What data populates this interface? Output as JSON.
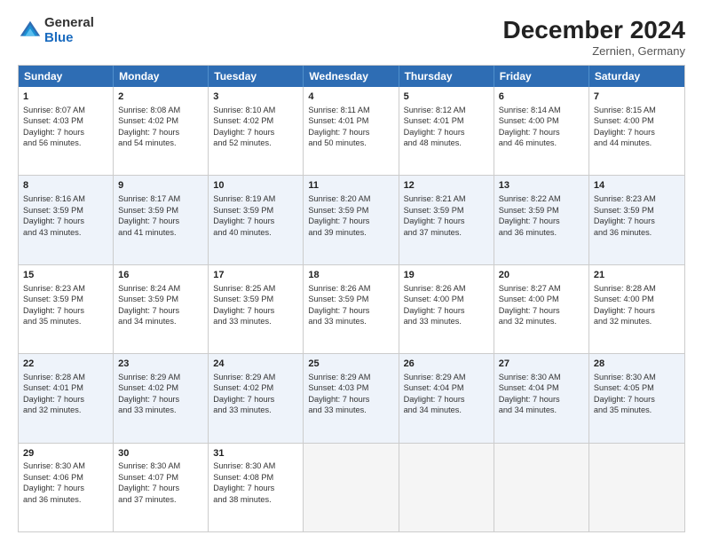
{
  "header": {
    "logo_general": "General",
    "logo_blue": "Blue",
    "month_title": "December 2024",
    "location": "Zernien, Germany"
  },
  "days_of_week": [
    "Sunday",
    "Monday",
    "Tuesday",
    "Wednesday",
    "Thursday",
    "Friday",
    "Saturday"
  ],
  "weeks": [
    [
      {
        "day": "1",
        "lines": [
          "Sunrise: 8:07 AM",
          "Sunset: 4:03 PM",
          "Daylight: 7 hours",
          "and 56 minutes."
        ]
      },
      {
        "day": "2",
        "lines": [
          "Sunrise: 8:08 AM",
          "Sunset: 4:02 PM",
          "Daylight: 7 hours",
          "and 54 minutes."
        ]
      },
      {
        "day": "3",
        "lines": [
          "Sunrise: 8:10 AM",
          "Sunset: 4:02 PM",
          "Daylight: 7 hours",
          "and 52 minutes."
        ]
      },
      {
        "day": "4",
        "lines": [
          "Sunrise: 8:11 AM",
          "Sunset: 4:01 PM",
          "Daylight: 7 hours",
          "and 50 minutes."
        ]
      },
      {
        "day": "5",
        "lines": [
          "Sunrise: 8:12 AM",
          "Sunset: 4:01 PM",
          "Daylight: 7 hours",
          "and 48 minutes."
        ]
      },
      {
        "day": "6",
        "lines": [
          "Sunrise: 8:14 AM",
          "Sunset: 4:00 PM",
          "Daylight: 7 hours",
          "and 46 minutes."
        ]
      },
      {
        "day": "7",
        "lines": [
          "Sunrise: 8:15 AM",
          "Sunset: 4:00 PM",
          "Daylight: 7 hours",
          "and 44 minutes."
        ]
      }
    ],
    [
      {
        "day": "8",
        "lines": [
          "Sunrise: 8:16 AM",
          "Sunset: 3:59 PM",
          "Daylight: 7 hours",
          "and 43 minutes."
        ]
      },
      {
        "day": "9",
        "lines": [
          "Sunrise: 8:17 AM",
          "Sunset: 3:59 PM",
          "Daylight: 7 hours",
          "and 41 minutes."
        ]
      },
      {
        "day": "10",
        "lines": [
          "Sunrise: 8:19 AM",
          "Sunset: 3:59 PM",
          "Daylight: 7 hours",
          "and 40 minutes."
        ]
      },
      {
        "day": "11",
        "lines": [
          "Sunrise: 8:20 AM",
          "Sunset: 3:59 PM",
          "Daylight: 7 hours",
          "and 39 minutes."
        ]
      },
      {
        "day": "12",
        "lines": [
          "Sunrise: 8:21 AM",
          "Sunset: 3:59 PM",
          "Daylight: 7 hours",
          "and 37 minutes."
        ]
      },
      {
        "day": "13",
        "lines": [
          "Sunrise: 8:22 AM",
          "Sunset: 3:59 PM",
          "Daylight: 7 hours",
          "and 36 minutes."
        ]
      },
      {
        "day": "14",
        "lines": [
          "Sunrise: 8:23 AM",
          "Sunset: 3:59 PM",
          "Daylight: 7 hours",
          "and 36 minutes."
        ]
      }
    ],
    [
      {
        "day": "15",
        "lines": [
          "Sunrise: 8:23 AM",
          "Sunset: 3:59 PM",
          "Daylight: 7 hours",
          "and 35 minutes."
        ]
      },
      {
        "day": "16",
        "lines": [
          "Sunrise: 8:24 AM",
          "Sunset: 3:59 PM",
          "Daylight: 7 hours",
          "and 34 minutes."
        ]
      },
      {
        "day": "17",
        "lines": [
          "Sunrise: 8:25 AM",
          "Sunset: 3:59 PM",
          "Daylight: 7 hours",
          "and 33 minutes."
        ]
      },
      {
        "day": "18",
        "lines": [
          "Sunrise: 8:26 AM",
          "Sunset: 3:59 PM",
          "Daylight: 7 hours",
          "and 33 minutes."
        ]
      },
      {
        "day": "19",
        "lines": [
          "Sunrise: 8:26 AM",
          "Sunset: 4:00 PM",
          "Daylight: 7 hours",
          "and 33 minutes."
        ]
      },
      {
        "day": "20",
        "lines": [
          "Sunrise: 8:27 AM",
          "Sunset: 4:00 PM",
          "Daylight: 7 hours",
          "and 32 minutes."
        ]
      },
      {
        "day": "21",
        "lines": [
          "Sunrise: 8:28 AM",
          "Sunset: 4:00 PM",
          "Daylight: 7 hours",
          "and 32 minutes."
        ]
      }
    ],
    [
      {
        "day": "22",
        "lines": [
          "Sunrise: 8:28 AM",
          "Sunset: 4:01 PM",
          "Daylight: 7 hours",
          "and 32 minutes."
        ]
      },
      {
        "day": "23",
        "lines": [
          "Sunrise: 8:29 AM",
          "Sunset: 4:02 PM",
          "Daylight: 7 hours",
          "and 33 minutes."
        ]
      },
      {
        "day": "24",
        "lines": [
          "Sunrise: 8:29 AM",
          "Sunset: 4:02 PM",
          "Daylight: 7 hours",
          "and 33 minutes."
        ]
      },
      {
        "day": "25",
        "lines": [
          "Sunrise: 8:29 AM",
          "Sunset: 4:03 PM",
          "Daylight: 7 hours",
          "and 33 minutes."
        ]
      },
      {
        "day": "26",
        "lines": [
          "Sunrise: 8:29 AM",
          "Sunset: 4:04 PM",
          "Daylight: 7 hours",
          "and 34 minutes."
        ]
      },
      {
        "day": "27",
        "lines": [
          "Sunrise: 8:30 AM",
          "Sunset: 4:04 PM",
          "Daylight: 7 hours",
          "and 34 minutes."
        ]
      },
      {
        "day": "28",
        "lines": [
          "Sunrise: 8:30 AM",
          "Sunset: 4:05 PM",
          "Daylight: 7 hours",
          "and 35 minutes."
        ]
      }
    ],
    [
      {
        "day": "29",
        "lines": [
          "Sunrise: 8:30 AM",
          "Sunset: 4:06 PM",
          "Daylight: 7 hours",
          "and 36 minutes."
        ]
      },
      {
        "day": "30",
        "lines": [
          "Sunrise: 8:30 AM",
          "Sunset: 4:07 PM",
          "Daylight: 7 hours",
          "and 37 minutes."
        ]
      },
      {
        "day": "31",
        "lines": [
          "Sunrise: 8:30 AM",
          "Sunset: 4:08 PM",
          "Daylight: 7 hours",
          "and 38 minutes."
        ]
      },
      {
        "day": "",
        "lines": []
      },
      {
        "day": "",
        "lines": []
      },
      {
        "day": "",
        "lines": []
      },
      {
        "day": "",
        "lines": []
      }
    ]
  ]
}
